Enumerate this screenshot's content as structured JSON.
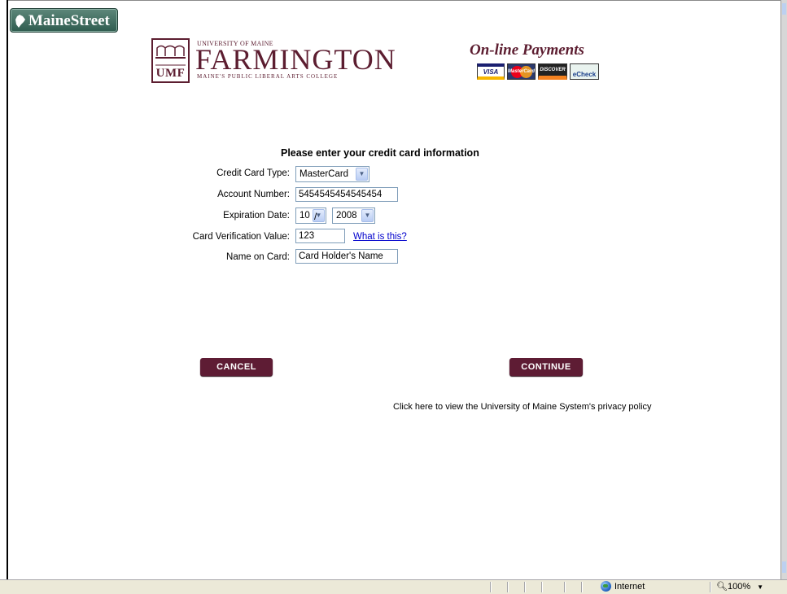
{
  "brand": {
    "badge_label": "MaineStreet",
    "university_line": "UNIVERSITY OF MAINE",
    "campus_name": "FARMINGTON",
    "campus_tagline": "MAINE'S PUBLIC LIBERAL ARTS COLLEGE",
    "campus_abbrev": "UMF",
    "brand_color": "#5c1d30"
  },
  "payments": {
    "title": "On-line Payments",
    "card_logos": [
      {
        "name": "visa-logo",
        "label": "VISA"
      },
      {
        "name": "mastercard-logo",
        "label": "MasterCard"
      },
      {
        "name": "discover-logo",
        "label": "DISCOVER"
      },
      {
        "name": "echeck-logo",
        "label": "eCheck"
      }
    ]
  },
  "form": {
    "title": "Please enter your credit card information",
    "card_type": {
      "label": "Credit Card Type:",
      "value": "MasterCard"
    },
    "account_number": {
      "label": "Account Number:",
      "value": "5454545454545454"
    },
    "expiration": {
      "label": "Expiration Date:",
      "month": "10",
      "year": "2008",
      "separator": "/"
    },
    "cvv": {
      "label": "Card Verification Value:",
      "value": "123",
      "help_link": "What is this?"
    },
    "name_on_card": {
      "label": "Name on Card:",
      "value": "Card Holder's Name"
    }
  },
  "actions": {
    "cancel_label": "CANCEL",
    "continue_label": "CONTINUE",
    "button_color": "#5e1c34"
  },
  "privacy_link": "Click here to view the University of Maine System's privacy policy",
  "statusbar": {
    "zone": "Internet",
    "zoom": "100%"
  }
}
